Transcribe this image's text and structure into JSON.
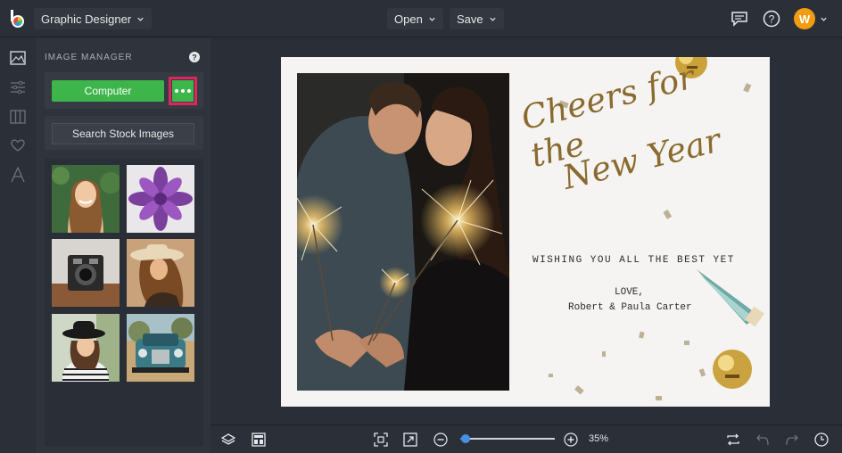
{
  "app": {
    "project_menu": "Graphic Designer",
    "open_label": "Open",
    "save_label": "Save",
    "avatar_initial": "W",
    "accent": "#3eb54a",
    "highlight": "#e0245e"
  },
  "panel": {
    "title": "IMAGE MANAGER",
    "computer_label": "Computer",
    "more_label": "•••",
    "stock_label": "Search Stock Images",
    "thumbnails": [
      {
        "name": "smiling-woman-photo"
      },
      {
        "name": "purple-succulent-photo"
      },
      {
        "name": "vintage-camera-photo"
      },
      {
        "name": "woman-in-hat-photo"
      },
      {
        "name": "woman-black-hat-photo"
      },
      {
        "name": "vintage-truck-photo"
      }
    ]
  },
  "rail": {
    "icons": [
      "image-icon",
      "sliders-icon",
      "layout-icon",
      "heart-icon",
      "text-icon"
    ]
  },
  "design": {
    "headline_line1": "Cheers for the",
    "headline_line2": "New Year",
    "subtitle": "WISHING YOU ALL THE BEST YET",
    "love": "LOVE,",
    "signature": "Robert & Paula Carter"
  },
  "bottombar": {
    "zoom": "35%"
  }
}
